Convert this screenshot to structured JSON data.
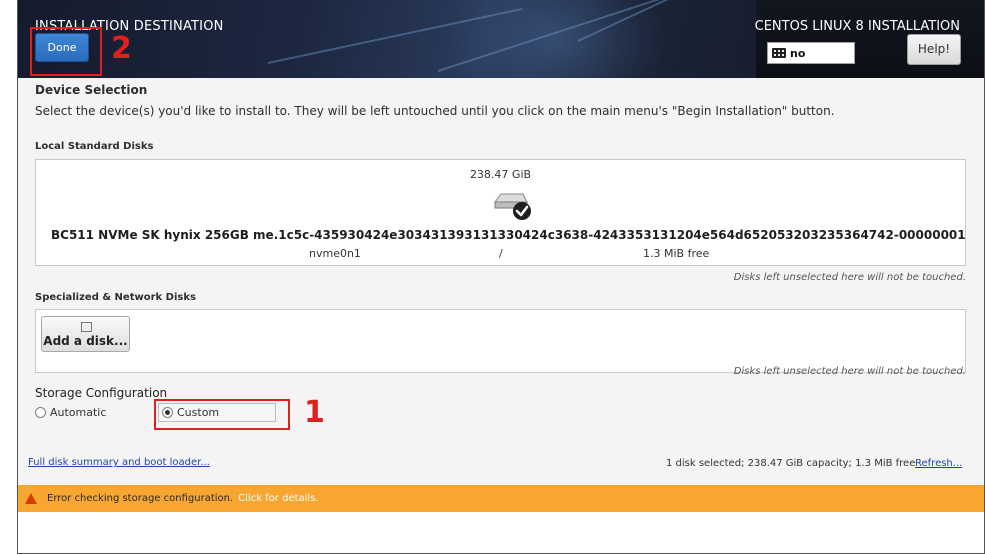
{
  "header": {
    "page_title": "INSTALLATION DESTINATION",
    "done_label": "Done",
    "product_title": "CENTOS LINUX 8 INSTALLATION",
    "keyboard_layout": "no",
    "help_label": "Help!"
  },
  "annotations": {
    "done_number": "2",
    "custom_number": "1",
    "highlight_color": "#e01f1f"
  },
  "device_selection": {
    "title": "Device Selection",
    "description": "Select the device(s) you'd like to install to.  They will be left untouched until you click on the main menu's \"Begin Installation\" button."
  },
  "local_disks": {
    "title": "Local Standard Disks",
    "disk": {
      "size": "238.47 GiB",
      "name": "BC511 NVMe SK hynix 256GB me.1c5c-435930424e303431393131330424c3638-4243353131204e564d652053203235364742-00000001",
      "device": "nvme0n1",
      "mount": "/",
      "free": "1.3 MiB free",
      "selected": true
    },
    "note": "Disks left unselected here will not be touched."
  },
  "specialized_disks": {
    "title": "Specialized & Network Disks",
    "add_disk_label": "Add a disk...",
    "note": "Disks left unselected here will not be touched."
  },
  "storage_configuration": {
    "title": "Storage Configuration",
    "options": [
      {
        "label": "Automatic",
        "checked": false
      },
      {
        "label": "Custom",
        "checked": true
      }
    ]
  },
  "footer": {
    "summary_link": "Full disk summary and boot loader...",
    "selection_summary": "1 disk selected; 238.47 GiB capacity; 1.3 MiB free",
    "refresh_link": "Refresh..."
  },
  "warning": {
    "text": "Error checking storage configuration.",
    "link": "Click for details.",
    "color": "#f7a631"
  },
  "colors": {
    "done_button": "#2a6cbd",
    "content_background": "#f4f4f4",
    "link": "#1d47a8"
  }
}
